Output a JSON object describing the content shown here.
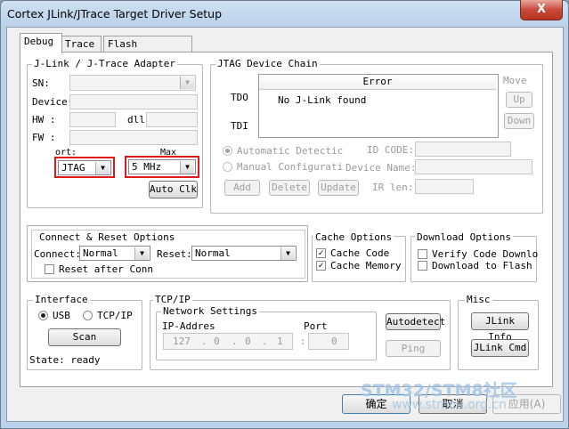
{
  "window": {
    "title": "Cortex JLink/JTrace Target Driver Setup",
    "close": "X"
  },
  "tabs": [
    "Debug",
    "Trace",
    "Flash Download"
  ],
  "adapter": {
    "legend": "J-Link / J-Trace Adapter",
    "sn_label": "SN:",
    "device_label": "Device:",
    "hw_label": "HW :",
    "dll_label": "dll",
    "fw_label": "FW :",
    "port_label": "ort:",
    "max_label": "Max",
    "port_value": "JTAG",
    "max_value": "5 MHz",
    "auto_clk": "Auto Clk"
  },
  "jtag": {
    "legend": "JTAG Device Chain",
    "tdo": "TDO",
    "tdi": "TDI",
    "col_error": "Error",
    "row_text": "No J-Link found",
    "move": "Move",
    "up": "Up",
    "down": "Down",
    "auto_detect": "Automatic Detectic",
    "manual_config": "Manual Configurati",
    "id_code": "ID CODE:",
    "device_name": "Device Name:",
    "ir_len": "IR len:",
    "add": "Add",
    "delete": "Delete",
    "update": "Update"
  },
  "connect": {
    "legend": "Connect & Reset Options",
    "connect_label": "Connect:",
    "connect_value": "Normal",
    "reset_label": "Reset:",
    "reset_value": "Normal",
    "reset_after": "Reset after Conn"
  },
  "cache": {
    "legend": "Cache Options",
    "code": "Cache Code",
    "memory": "Cache Memory",
    "check": "✓"
  },
  "download": {
    "legend": "Download Options",
    "verify": "Verify Code Downlo",
    "to_flash": "Download to Flash"
  },
  "interface": {
    "legend": "Interface",
    "usb": "USB",
    "tcpip": "TCP/IP",
    "scan": "Scan",
    "state": "State: ready"
  },
  "tcpip": {
    "legend": "TCP/IP",
    "network": "Network Settings",
    "ip_label": "IP-Addres",
    "port_label": "Port",
    "ip_parts": [
      "127",
      "0",
      "0",
      "1"
    ],
    "dot": ".",
    "colon": ":",
    "port_value": "0",
    "autodetect": "Autodetect",
    "ping": "Ping"
  },
  "misc": {
    "legend": "Misc",
    "jlink_info": "JLink Info",
    "jlink_cmd": "JLink Cmd"
  },
  "footer": {
    "ok": "确定",
    "cancel": "取消",
    "apply": "应用(A)"
  },
  "watermark": {
    "line1": "STM32/STM8社区",
    "line2": "www.stmcu.org.cn"
  }
}
